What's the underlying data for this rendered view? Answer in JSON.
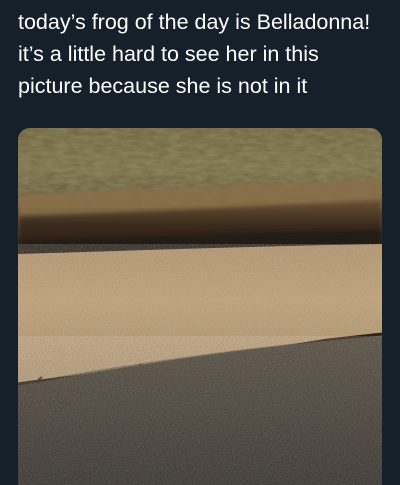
{
  "tweet": {
    "text_lines": [
      "today’s frog of the day is Belladonna!",
      "it’s a little hard to see her in this",
      "picture because she is not in it"
    ]
  },
  "photo": {
    "icon": "roadside-curb-photo"
  },
  "colors": {
    "background": "#15202b",
    "text": "#ffffff"
  }
}
